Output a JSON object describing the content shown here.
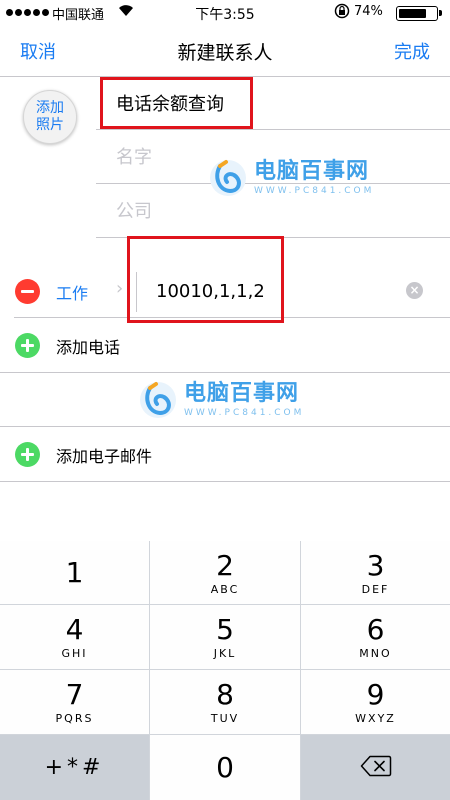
{
  "status": {
    "carrier": "中国联通",
    "time": "下午3:55",
    "battery_pct": "74%",
    "battery_level": 0.74
  },
  "nav": {
    "cancel": "取消",
    "title": "新建联系人",
    "done": "完成"
  },
  "photo": {
    "label": "添加照片"
  },
  "fields": {
    "first_name_value": "电话余额查询",
    "last_name_placeholder": "名字",
    "company_placeholder": "公司"
  },
  "phone": {
    "label": "工作",
    "value": "10010,1,1,2"
  },
  "actions": {
    "add_phone": "添加电话",
    "add_email": "添加电子邮件"
  },
  "watermark": {
    "title": "电脑百事网",
    "subtitle": "WWW.PC841.COM"
  },
  "keypad": {
    "keys": [
      {
        "num": "1",
        "letters": ""
      },
      {
        "num": "2",
        "letters": "ABC"
      },
      {
        "num": "3",
        "letters": "DEF"
      },
      {
        "num": "4",
        "letters": "GHI"
      },
      {
        "num": "5",
        "letters": "JKL"
      },
      {
        "num": "6",
        "letters": "MNO"
      },
      {
        "num": "7",
        "letters": "PQRS"
      },
      {
        "num": "8",
        "letters": "TUV"
      },
      {
        "num": "9",
        "letters": "WXYZ"
      }
    ],
    "symbols": "+*#",
    "zero": "0"
  },
  "colors": {
    "accent": "#1a7cf2",
    "remove": "#ff3b30",
    "add": "#4cd964",
    "highlight": "#e0141c"
  }
}
